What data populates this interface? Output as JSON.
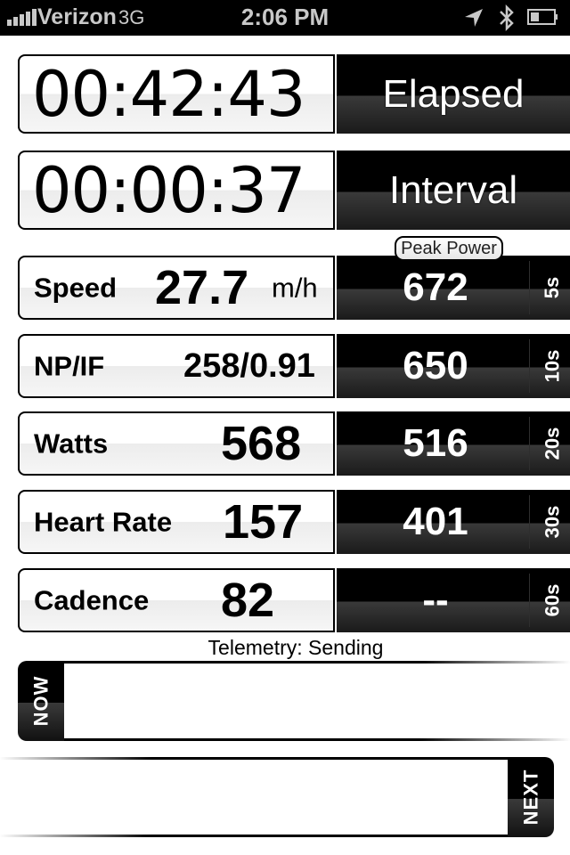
{
  "status_bar": {
    "carrier": "Verizon",
    "network": "3G",
    "time": "2:06 PM",
    "signal_bars": 5,
    "icons": [
      "location-arrow-icon",
      "bluetooth-icon",
      "battery-icon"
    ],
    "battery_level_percent": 35
  },
  "timers": [
    {
      "value": "00:42:43",
      "label": "Elapsed"
    },
    {
      "value": "00:00:37",
      "label": "Interval"
    }
  ],
  "peak_power": {
    "title": "Peak Power"
  },
  "metrics": [
    {
      "label": "Speed",
      "value": "27.7",
      "unit": "m/h",
      "peak": "672",
      "window": "5s"
    },
    {
      "label": "NP/IF",
      "value": "258/0.91",
      "unit": "",
      "peak": "650",
      "window": "10s"
    },
    {
      "label": "Watts",
      "value": "568",
      "unit": "",
      "peak": "516",
      "window": "20s"
    },
    {
      "label": "Heart Rate",
      "value": "157",
      "unit": "",
      "peak": "401",
      "window": "30s"
    },
    {
      "label": "Cadence",
      "value": "82",
      "unit": "",
      "peak": "--",
      "window": "60s"
    }
  ],
  "telemetry": {
    "text": "Telemetry:  Sending"
  },
  "workout": {
    "now_label": "NOW",
    "now_content": "",
    "next_label": "NEXT",
    "next_content": ""
  },
  "colors": {
    "panel_dark": "#000000",
    "panel_light": "#ffffff",
    "text_light": "#ffffff",
    "status_text": "#c8c8c8"
  }
}
